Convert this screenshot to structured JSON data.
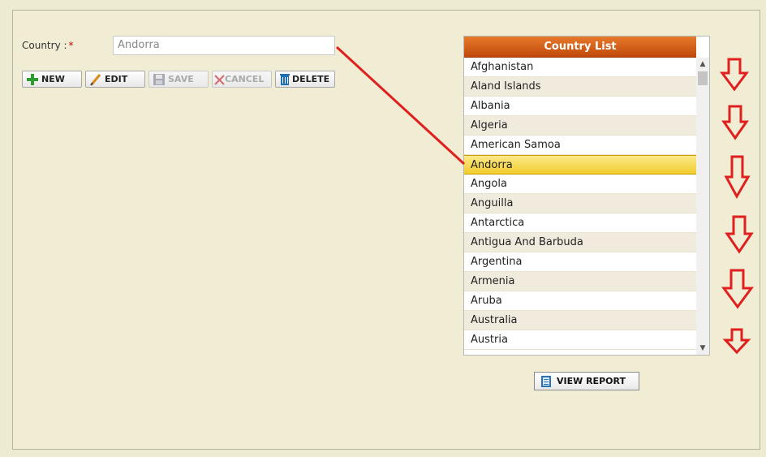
{
  "form": {
    "country_label": "Country :",
    "required_mark": "*",
    "country_value": "Andorra"
  },
  "toolbar": {
    "new_label": "NEW",
    "edit_label": "EDIT",
    "save_label": "SAVE",
    "cancel_label": "CANCEL",
    "delete_label": "DELETE"
  },
  "country_list": {
    "title": "Country List",
    "selected": "Andorra",
    "items": [
      "Afghanistan",
      "Aland Islands",
      "Albania",
      "Algeria",
      "American Samoa",
      "Andorra",
      "Angola",
      "Anguilla",
      "Antarctica",
      "Antigua And Barbuda",
      "Argentina",
      "Armenia",
      "Aruba",
      "Australia",
      "Austria"
    ]
  },
  "report": {
    "view_report_label": "VIEW REPORT"
  },
  "colors": {
    "header": "#c1490b",
    "selected_row": "#f2cc2c",
    "annotation": "#e0201f"
  }
}
